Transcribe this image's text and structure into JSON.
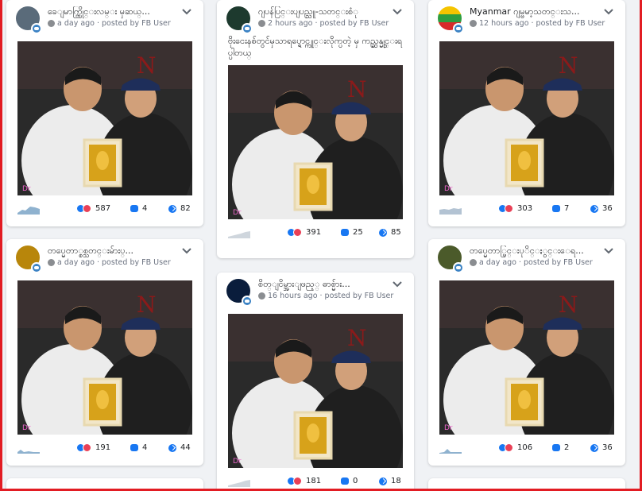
{
  "posts": [
    {
      "page_name": "ခေျမာက္ကြိုင္းလမ္း မှဆယ္...",
      "time": "a day ago",
      "posted_by": "posted by FB User",
      "caption": "",
      "avatar_color": "#5a6b7a",
      "spark_color": "#8fb2cf",
      "reactions": "587",
      "comments": "4",
      "shares": "82"
    },
    {
      "page_name": "ဂျပန်ပြင္းပျပည္သူ-သတင္းစံု",
      "time": "2 hours ago",
      "posted_by": "posted by FB User",
      "caption": "ဗိုးငေးနစ်တွင်မှသာရပ္ရောင္ကုုင္းလိုက္ပတဲ့ မှ ကည္ဆန္မွုင္းရပ္ပါတယ္",
      "avatar_color": "#1d3a2e",
      "spark_color": "#cfd6dd",
      "reactions": "391",
      "comments": "25",
      "shares": "85"
    },
    {
      "page_name": "Myanmar ဂျမ္ဗမာ့သတင္းသ...",
      "time": "12 hours ago",
      "posted_by": "posted by FB User",
      "caption": "",
      "avatar_color": "#2e9e3f",
      "spark_color": "#b3c3d3",
      "reactions": "303",
      "comments": "7",
      "shares": "36"
    },
    {
      "page_name": "တပ္မေတာ္စစ္သတင္းမ်ားပ္...",
      "time": "a day ago",
      "posted_by": "posted by FB User",
      "caption": "",
      "avatar_color": "#b8860b",
      "spark_color": "#8fb2cf",
      "reactions": "191",
      "comments": "4",
      "shares": "44"
    },
    {
      "page_name": "စိတ္ျငိမ္အားျဖည့္ ဓာစ္မ်ား...",
      "time": "16 hours ago",
      "posted_by": "posted by FB User",
      "caption": "",
      "avatar_color": "#0a1d3c",
      "spark_color": "#cfd6dd",
      "reactions": "181",
      "comments": "0",
      "shares": "18"
    },
    {
      "page_name": "တပ္မေတာ္ပြင္းပုိင္ႏွင္းေရ...",
      "time": "a day ago",
      "posted_by": "posted by FB User",
      "caption": "",
      "avatar_color": "#4b5a2a",
      "spark_color": "#8fb2cf",
      "reactions": "106",
      "comments": "2",
      "shares": "36"
    }
  ],
  "photo_watermark": "Dr",
  "colors": {
    "accent": "#1877f2",
    "frame": "#e21c23",
    "background": "#f0f2f5"
  }
}
